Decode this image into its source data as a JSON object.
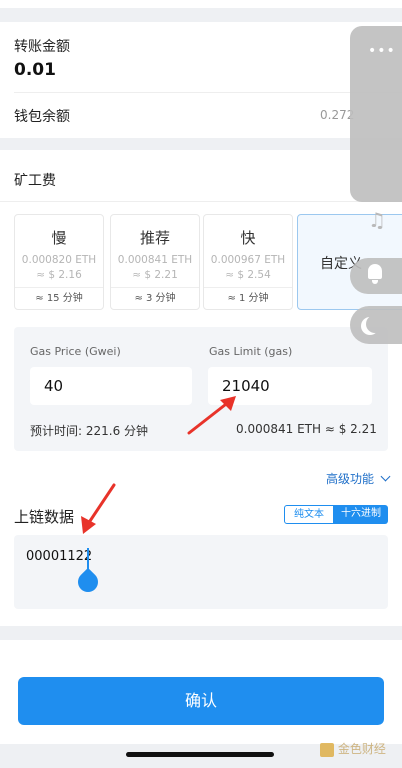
{
  "transfer": {
    "amount_label": "转账金额",
    "amount_value": "0.01",
    "balance_label": "钱包余额",
    "balance_value": "0.272"
  },
  "fee": {
    "title": "矿工费",
    "options": [
      {
        "name": "慢",
        "eth": "0.000820 ETH",
        "usd": "≈ $ 2.16",
        "time": "≈ 15 分钟"
      },
      {
        "name": "推荐",
        "eth": "0.000841 ETH",
        "usd": "≈ $ 2.21",
        "time": "≈ 3 分钟"
      },
      {
        "name": "快",
        "eth": "0.000967 ETH",
        "usd": "≈ $ 2.54",
        "time": "≈ 1 分钟"
      }
    ],
    "custom_label": "自定义"
  },
  "gas": {
    "price_label": "Gas Price (Gwei)",
    "price_value": "40",
    "limit_label": "Gas Limit (gas)",
    "limit_value": "21040",
    "est_time": "预计时间: 221.6 分钟",
    "total": "0.000841 ETH ≈ $ 2.21"
  },
  "advanced": "高级功能",
  "chain": {
    "title": "上链数据",
    "text_tab": "纯文本",
    "hex_tab": "十六进制",
    "value": "00001122"
  },
  "confirm_label": "确认",
  "watermark": "金色财经",
  "colors": {
    "accent": "#1f8eef",
    "arrow": "#e8332a"
  },
  "icons": [
    "more-icon",
    "music-note-icon",
    "bell-icon",
    "moon-icon",
    "chevron-down-icon",
    "text-cursor-handle-icon",
    "annotation-arrow-icon"
  ]
}
